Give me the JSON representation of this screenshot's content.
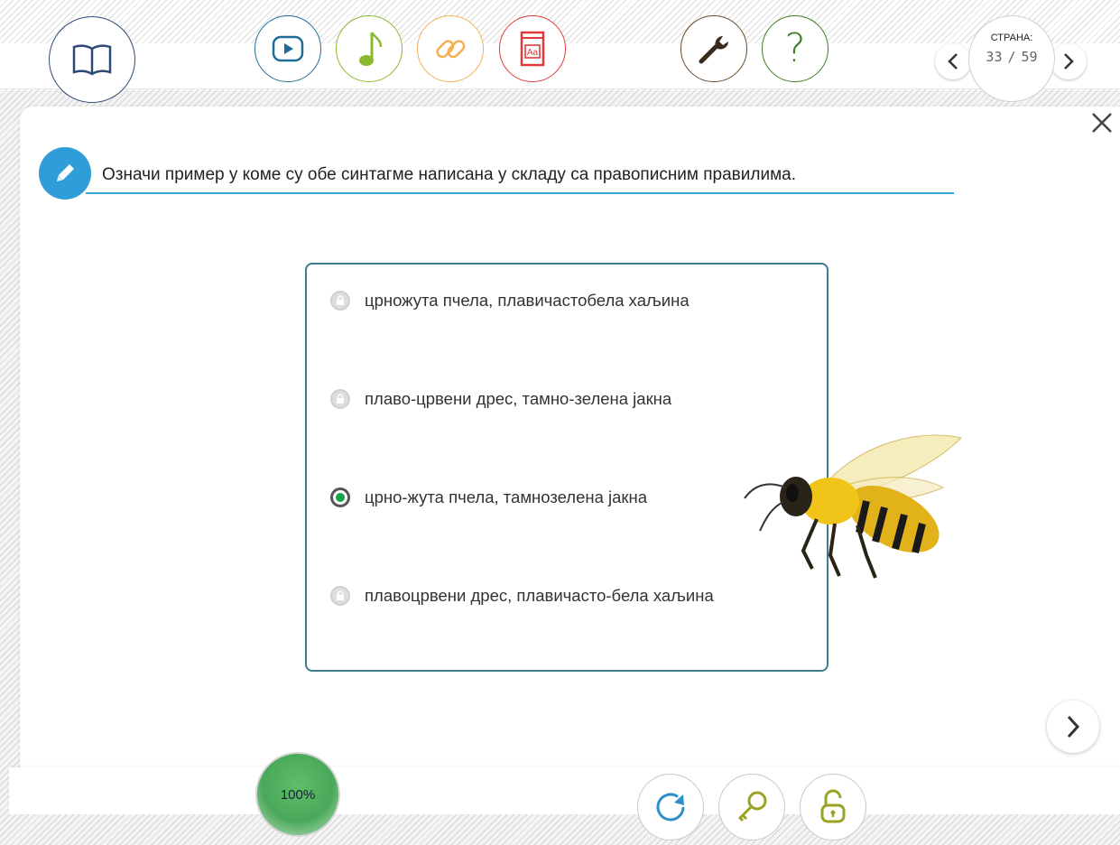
{
  "toolbar": {
    "book_icon": "book-icon",
    "video_icon": "play-icon",
    "music_icon": "music-note-icon",
    "link_icon": "link-icon",
    "dictionary_icon": "dictionary-icon",
    "tools_icon": "wrench-icon",
    "help_label": "?",
    "page_label": "СТРАНА:",
    "page_current": "33",
    "page_separator": "/",
    "page_total": "59"
  },
  "colors": {
    "book": "#2c4a73",
    "video": "#1f6c96",
    "music": "#8ab92f",
    "link": "#f4b054",
    "dictionary": "#e23a3a",
    "tools": "#6b4b2a",
    "help": "#3f7d24",
    "accent": "#3ca3d6",
    "selected": "#16a34a"
  },
  "exercise": {
    "instruction": "Означи пример у коме су обе синтагме написана у складу са правописним правилима.",
    "options": [
      {
        "label": "црножута пчела, плавичастобела хаљина",
        "state": "locked"
      },
      {
        "label": "плаво-црвени дрес, тамно-зелена јакна",
        "state": "locked"
      },
      {
        "label": "црно-жута пчела, тамнозелена јакна",
        "state": "selected"
      },
      {
        "label": "плавоцрвени дрес, плавичасто-бела хаљина",
        "state": "locked"
      }
    ]
  },
  "footer": {
    "score": "100%"
  }
}
